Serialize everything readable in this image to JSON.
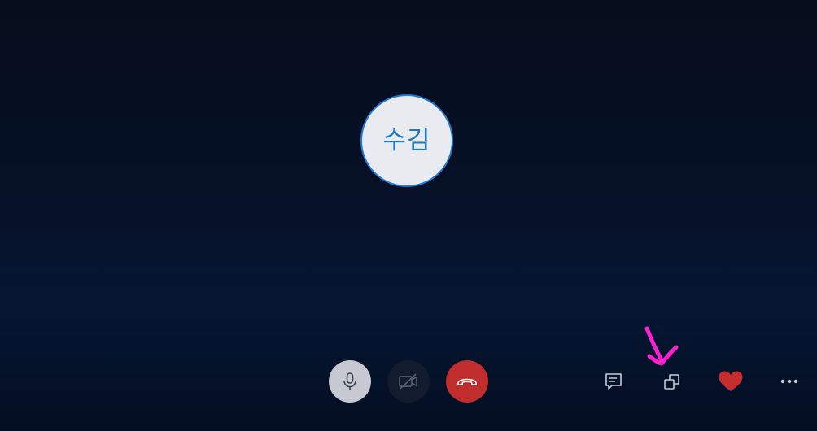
{
  "call": {
    "participant_initials": "수김"
  },
  "controls": {
    "mic_icon": "microphone-icon",
    "video_icon": "video-off-icon",
    "hangup_icon": "phone-hangup-icon",
    "chat_icon": "chat-icon",
    "share_icon": "screen-share-icon",
    "react_icon": "heart-icon",
    "more_icon": "more-options-icon"
  },
  "colors": {
    "background": "#061127",
    "avatar_fill": "#e9ebf1",
    "avatar_accent": "#1a7ad4",
    "hangup": "#bf2d2d",
    "heart": "#c62d2d",
    "annotation": "#ff1fd2"
  }
}
